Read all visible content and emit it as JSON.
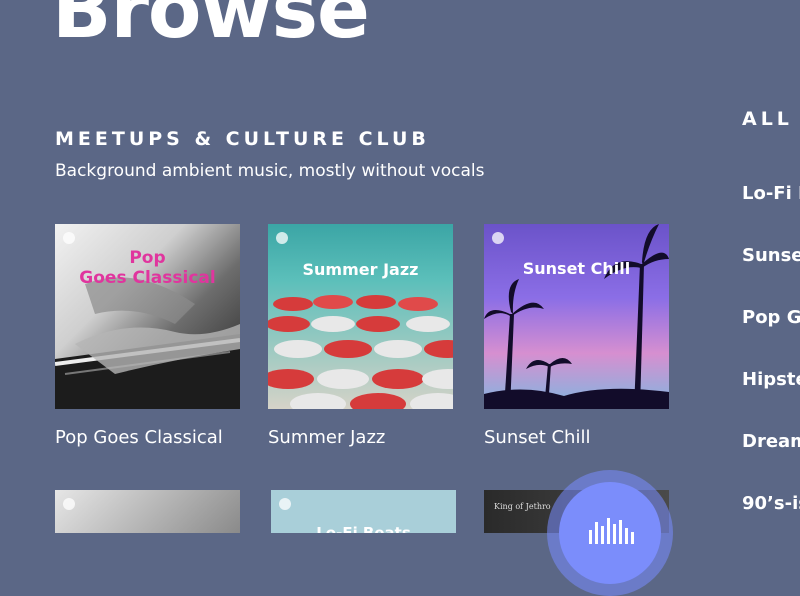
{
  "page": {
    "title": "Browse"
  },
  "section": {
    "heading": "MEETUPS & CULTURE CLUB",
    "subtitle": "Background ambient music, mostly without vocals"
  },
  "playlists": [
    {
      "caption": "Pop Goes Classical",
      "art_title": "Pop\nGoes Classical",
      "art_title_color": "#e0359e"
    },
    {
      "caption": "Summer Jazz",
      "art_title": "Summer Jazz",
      "art_title_color": "#ffffff"
    },
    {
      "caption": "Sunset Chill",
      "art_title": "Sunset Chill",
      "art_title_color": "#ffffff"
    }
  ],
  "second_row": [
    {
      "art_title": "Lo-Fi Beats"
    },
    {
      "art_title": "King of Jethro"
    }
  ],
  "right_column": {
    "heading": "ALL",
    "items": [
      "Lo-Fi B",
      "Sunset",
      "Pop Go",
      "Hipste",
      "Dream",
      "90’s-is"
    ]
  },
  "colors": {
    "background": "#5b6786",
    "accent": "#7b8dfb"
  },
  "icons": {
    "fab": "audio-wave-icon",
    "badge": "spotify-icon"
  }
}
